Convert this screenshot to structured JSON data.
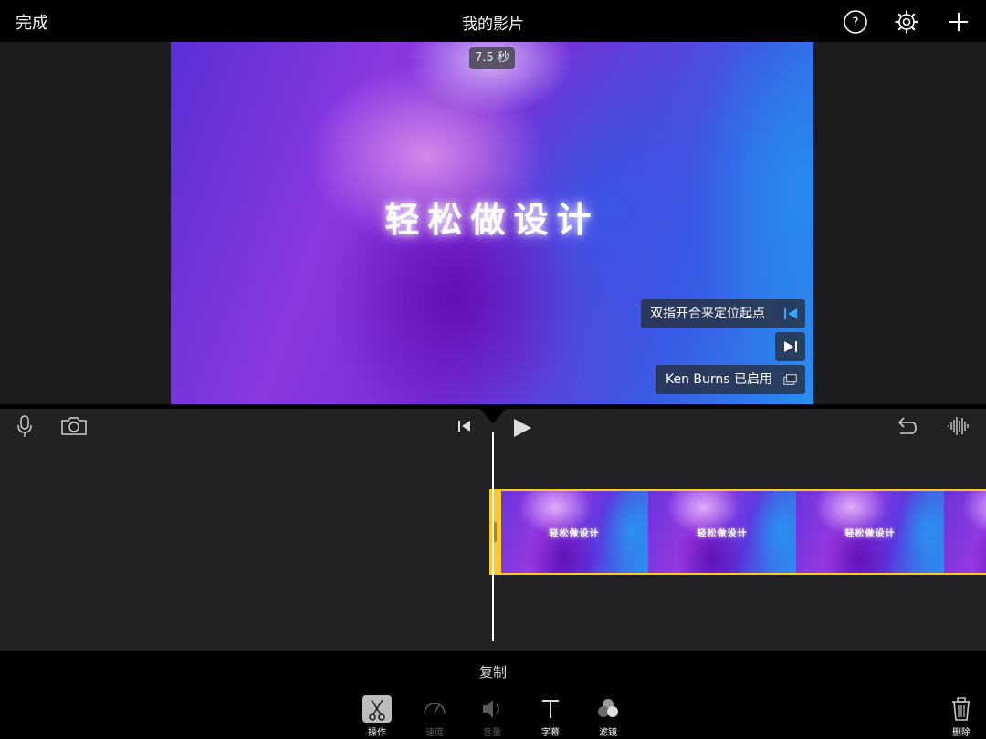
{
  "topbar": {
    "done_label": "完成",
    "title": "我的影片",
    "icons": [
      "help-icon",
      "settings-gear-icon",
      "add-icon"
    ]
  },
  "viewer": {
    "duration_badge": "7.5 秒",
    "video_title_text": "轻松做设计",
    "hints": {
      "pinch_to_set_start": "双指开合来定位起点",
      "ken_burns": "Ken Burns 已启用"
    }
  },
  "timeline": {
    "icons": [
      "microphone-icon",
      "camera-icon",
      "skip-to-start-icon",
      "play-icon",
      "undo-icon",
      "audio-waveform-icon"
    ],
    "clip_frame_text": "轻松做设计",
    "clip_frame_count": 4
  },
  "bottom": {
    "action_label": "复制",
    "tools": [
      {
        "label": "操作",
        "icon": "scissors-icon",
        "active": true
      },
      {
        "label": "速度",
        "icon": "speedometer-icon",
        "active": false
      },
      {
        "label": "音量",
        "icon": "volume-icon",
        "active": false
      },
      {
        "label": "字幕",
        "icon": "text-icon",
        "active": false
      },
      {
        "label": "滤镜",
        "icon": "filter-icon",
        "active": false
      }
    ],
    "delete_label": "删除"
  },
  "colors": {
    "accent_yellow": "#f7c92e",
    "background": "#1c1c1e",
    "bar": "#000000"
  }
}
